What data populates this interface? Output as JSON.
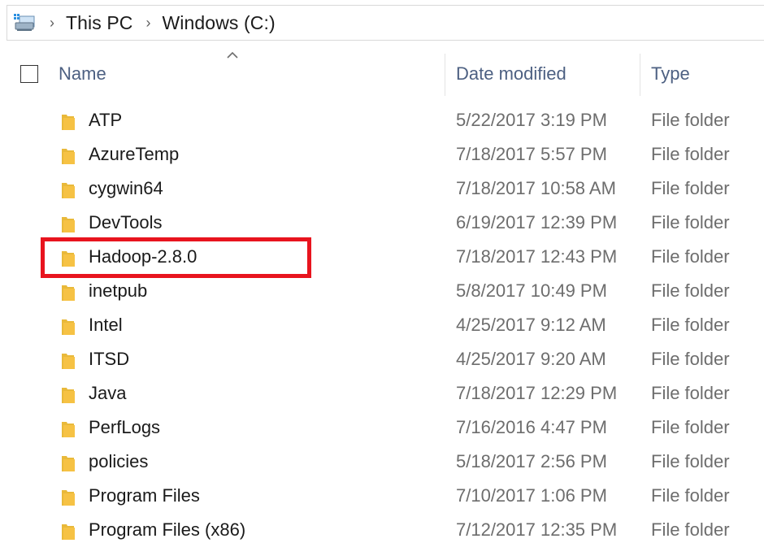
{
  "address_bar": {
    "icon": "this-pc-icon",
    "crumbs": [
      "This PC",
      "Windows (C:)"
    ]
  },
  "columns": {
    "name": "Name",
    "date_modified": "Date modified",
    "type": "Type"
  },
  "colors": {
    "highlight": "#e8141e",
    "folder": "#f6c244",
    "header_text": "#4d6082"
  },
  "rows": [
    {
      "name": "ATP",
      "date": "5/22/2017 3:19 PM",
      "type": "File folder"
    },
    {
      "name": "AzureTemp",
      "date": "7/18/2017 5:57 PM",
      "type": "File folder"
    },
    {
      "name": "cygwin64",
      "date": "7/18/2017 10:58 AM",
      "type": "File folder"
    },
    {
      "name": "DevTools",
      "date": "6/19/2017 12:39 PM",
      "type": "File folder"
    },
    {
      "name": "Hadoop-2.8.0",
      "date": "7/18/2017 12:43 PM",
      "type": "File folder"
    },
    {
      "name": "inetpub",
      "date": "5/8/2017 10:49 PM",
      "type": "File folder"
    },
    {
      "name": "Intel",
      "date": "4/25/2017 9:12 AM",
      "type": "File folder"
    },
    {
      "name": "ITSD",
      "date": "4/25/2017 9:20 AM",
      "type": "File folder"
    },
    {
      "name": "Java",
      "date": "7/18/2017 12:29 PM",
      "type": "File folder"
    },
    {
      "name": "PerfLogs",
      "date": "7/16/2016 4:47 PM",
      "type": "File folder"
    },
    {
      "name": "policies",
      "date": "5/18/2017 2:56 PM",
      "type": "File folder"
    },
    {
      "name": "Program Files",
      "date": "7/10/2017 1:06 PM",
      "type": "File folder"
    },
    {
      "name": "Program Files (x86)",
      "date": "7/12/2017 12:35 PM",
      "type": "File folder"
    }
  ]
}
